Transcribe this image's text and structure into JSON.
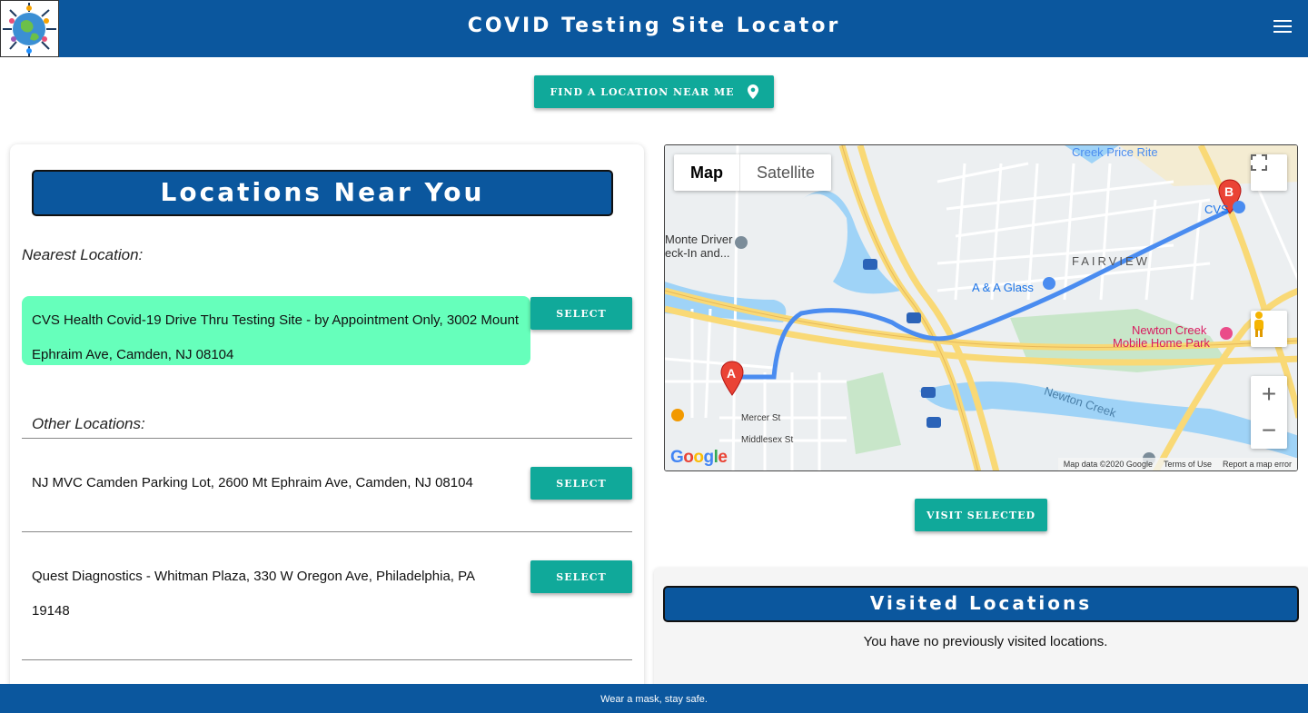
{
  "header": {
    "title": "COVID Testing Site Locator",
    "menu_icon": "hamburger-menu-icon",
    "logo_icon": "globe-virus-logo-icon"
  },
  "find_button": {
    "label": "Find a location near me",
    "icon": "location-pin-icon"
  },
  "locations": {
    "title": "Locations Near You",
    "nearest_label": "Nearest Location:",
    "nearest": {
      "text": "CVS Health Covid-19 Drive Thru Testing Site - by Appointment Only, 3002 Mount Ephraim Ave, Camden, NJ 08104",
      "select_label": "Select"
    },
    "other_label": "Other Locations:",
    "others": [
      {
        "text": "NJ MVC Camden Parking Lot, 2600 Mt Ephraim Ave, Camden, NJ 08104",
        "select_label": "Select"
      },
      {
        "text": "Quest Diagnostics - Whitman Plaza, 330 W Oregon Ave, Philadelphia, PA 19148",
        "select_label": "Select"
      }
    ]
  },
  "map": {
    "type_map": "Map",
    "type_satellite": "Satellite",
    "marker_a": "A",
    "marker_b": "B",
    "labels": {
      "fairview": "FAIRVIEW",
      "newton_creek": "Newton Creek",
      "newton_creek_mhp_1": "Newton Creek",
      "newton_creek_mhp_2": "Mobile Home Park",
      "aa_glass": "A & A Glass",
      "cvs": "CVS",
      "monte_driver_1": "Monte Driver",
      "monte_driver_2": "eck-In and...",
      "price_rite": "Creek Price Rite",
      "mercer": "Mercer St",
      "middlesex": "Middlesex St"
    },
    "attribution": "Map data ©2020 Google",
    "terms": "Terms of Use",
    "report": "Report a map error",
    "google": "Google"
  },
  "visit_button": {
    "label": "Visit Selected"
  },
  "visited": {
    "title": "Visited Locations",
    "empty": "You have no previously visited locations."
  },
  "footer": {
    "text": "Wear a mask, stay safe."
  },
  "colors": {
    "brand": "#0b579e",
    "accent": "#10a99a",
    "highlight": "#66ffbb"
  }
}
